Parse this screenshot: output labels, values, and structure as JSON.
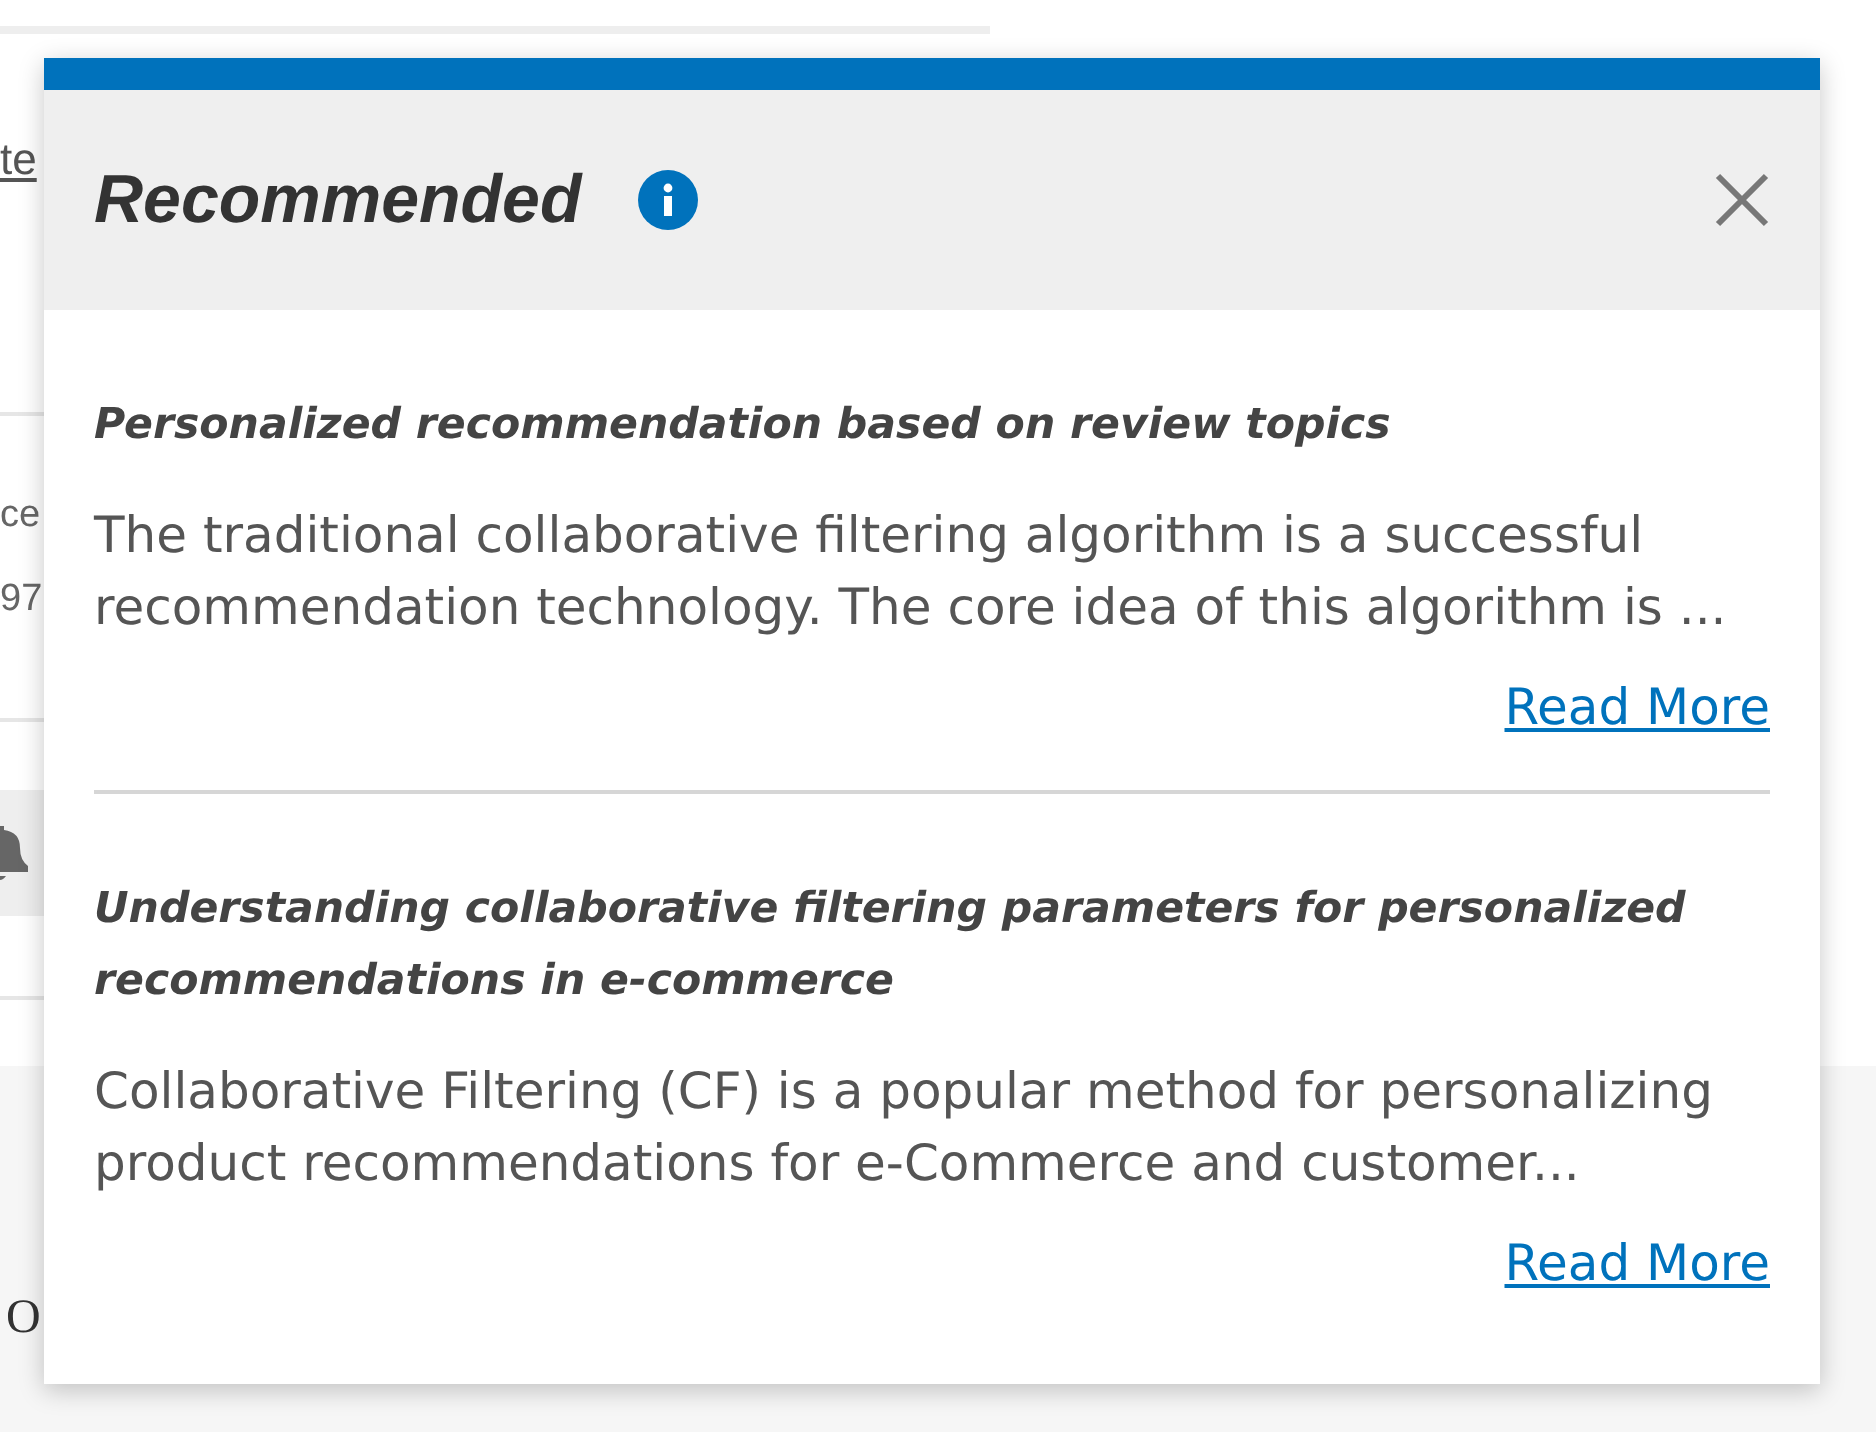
{
  "background": {
    "link_fragment": "te",
    "text_fragments": [
      "ce",
      "97"
    ],
    "serif_fragment": "O"
  },
  "popup": {
    "title": "Recommended",
    "items": [
      {
        "title": "Personalized recommendation based on review topics",
        "summary": "The traditional collaborative filtering algorithm is a successful recommendation technology. The core idea of this algorithm is ...",
        "link": "Read More"
      },
      {
        "title": "Understanding collaborative filtering parameters for personalized recommendations in e-commerce",
        "summary": "Collaborative Filtering (CF) is a popular method for personalizing product recommendations for e-Commerce and customer...",
        "link": "Read More"
      }
    ]
  }
}
